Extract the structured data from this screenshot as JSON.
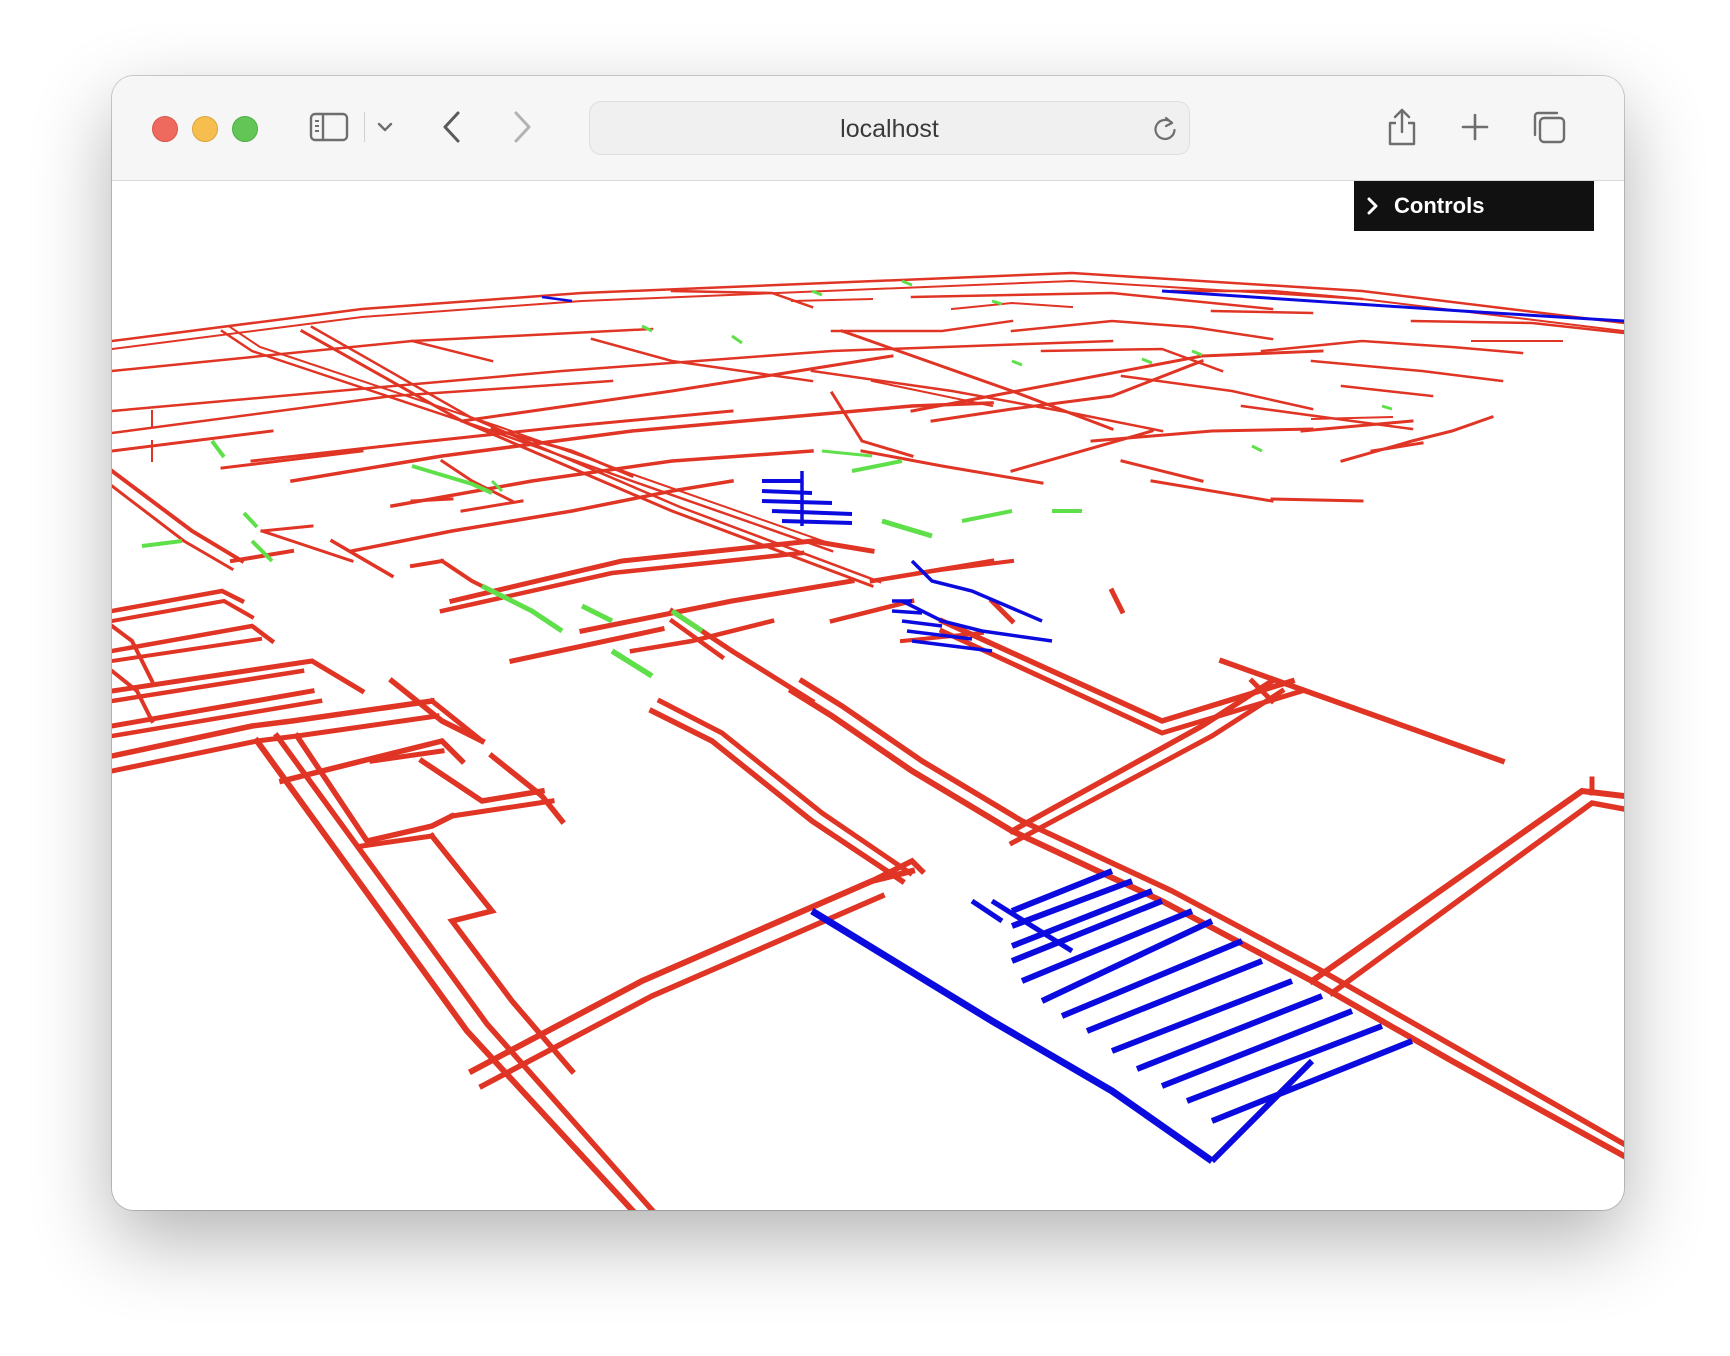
{
  "browser": {
    "address": "localhost",
    "icons": {
      "close": "close-icon",
      "minimize": "minimize-icon",
      "zoom": "zoom-icon",
      "sidebar": "sidebar-icon",
      "sidebar_menu": "chevron-down-icon",
      "back": "back-icon",
      "forward": "forward-icon",
      "reload": "reload-icon",
      "share": "share-icon",
      "new_tab": "plus-icon",
      "tabs": "tabs-overview-icon"
    }
  },
  "gui": {
    "controls_label": "Controls",
    "toggle_icon": "chevron-right-icon"
  },
  "scene": {
    "wall_color": "#e03424",
    "door_color": "#5fe04a",
    "stair_color": "#0b0be0",
    "background": "#ffffff"
  }
}
